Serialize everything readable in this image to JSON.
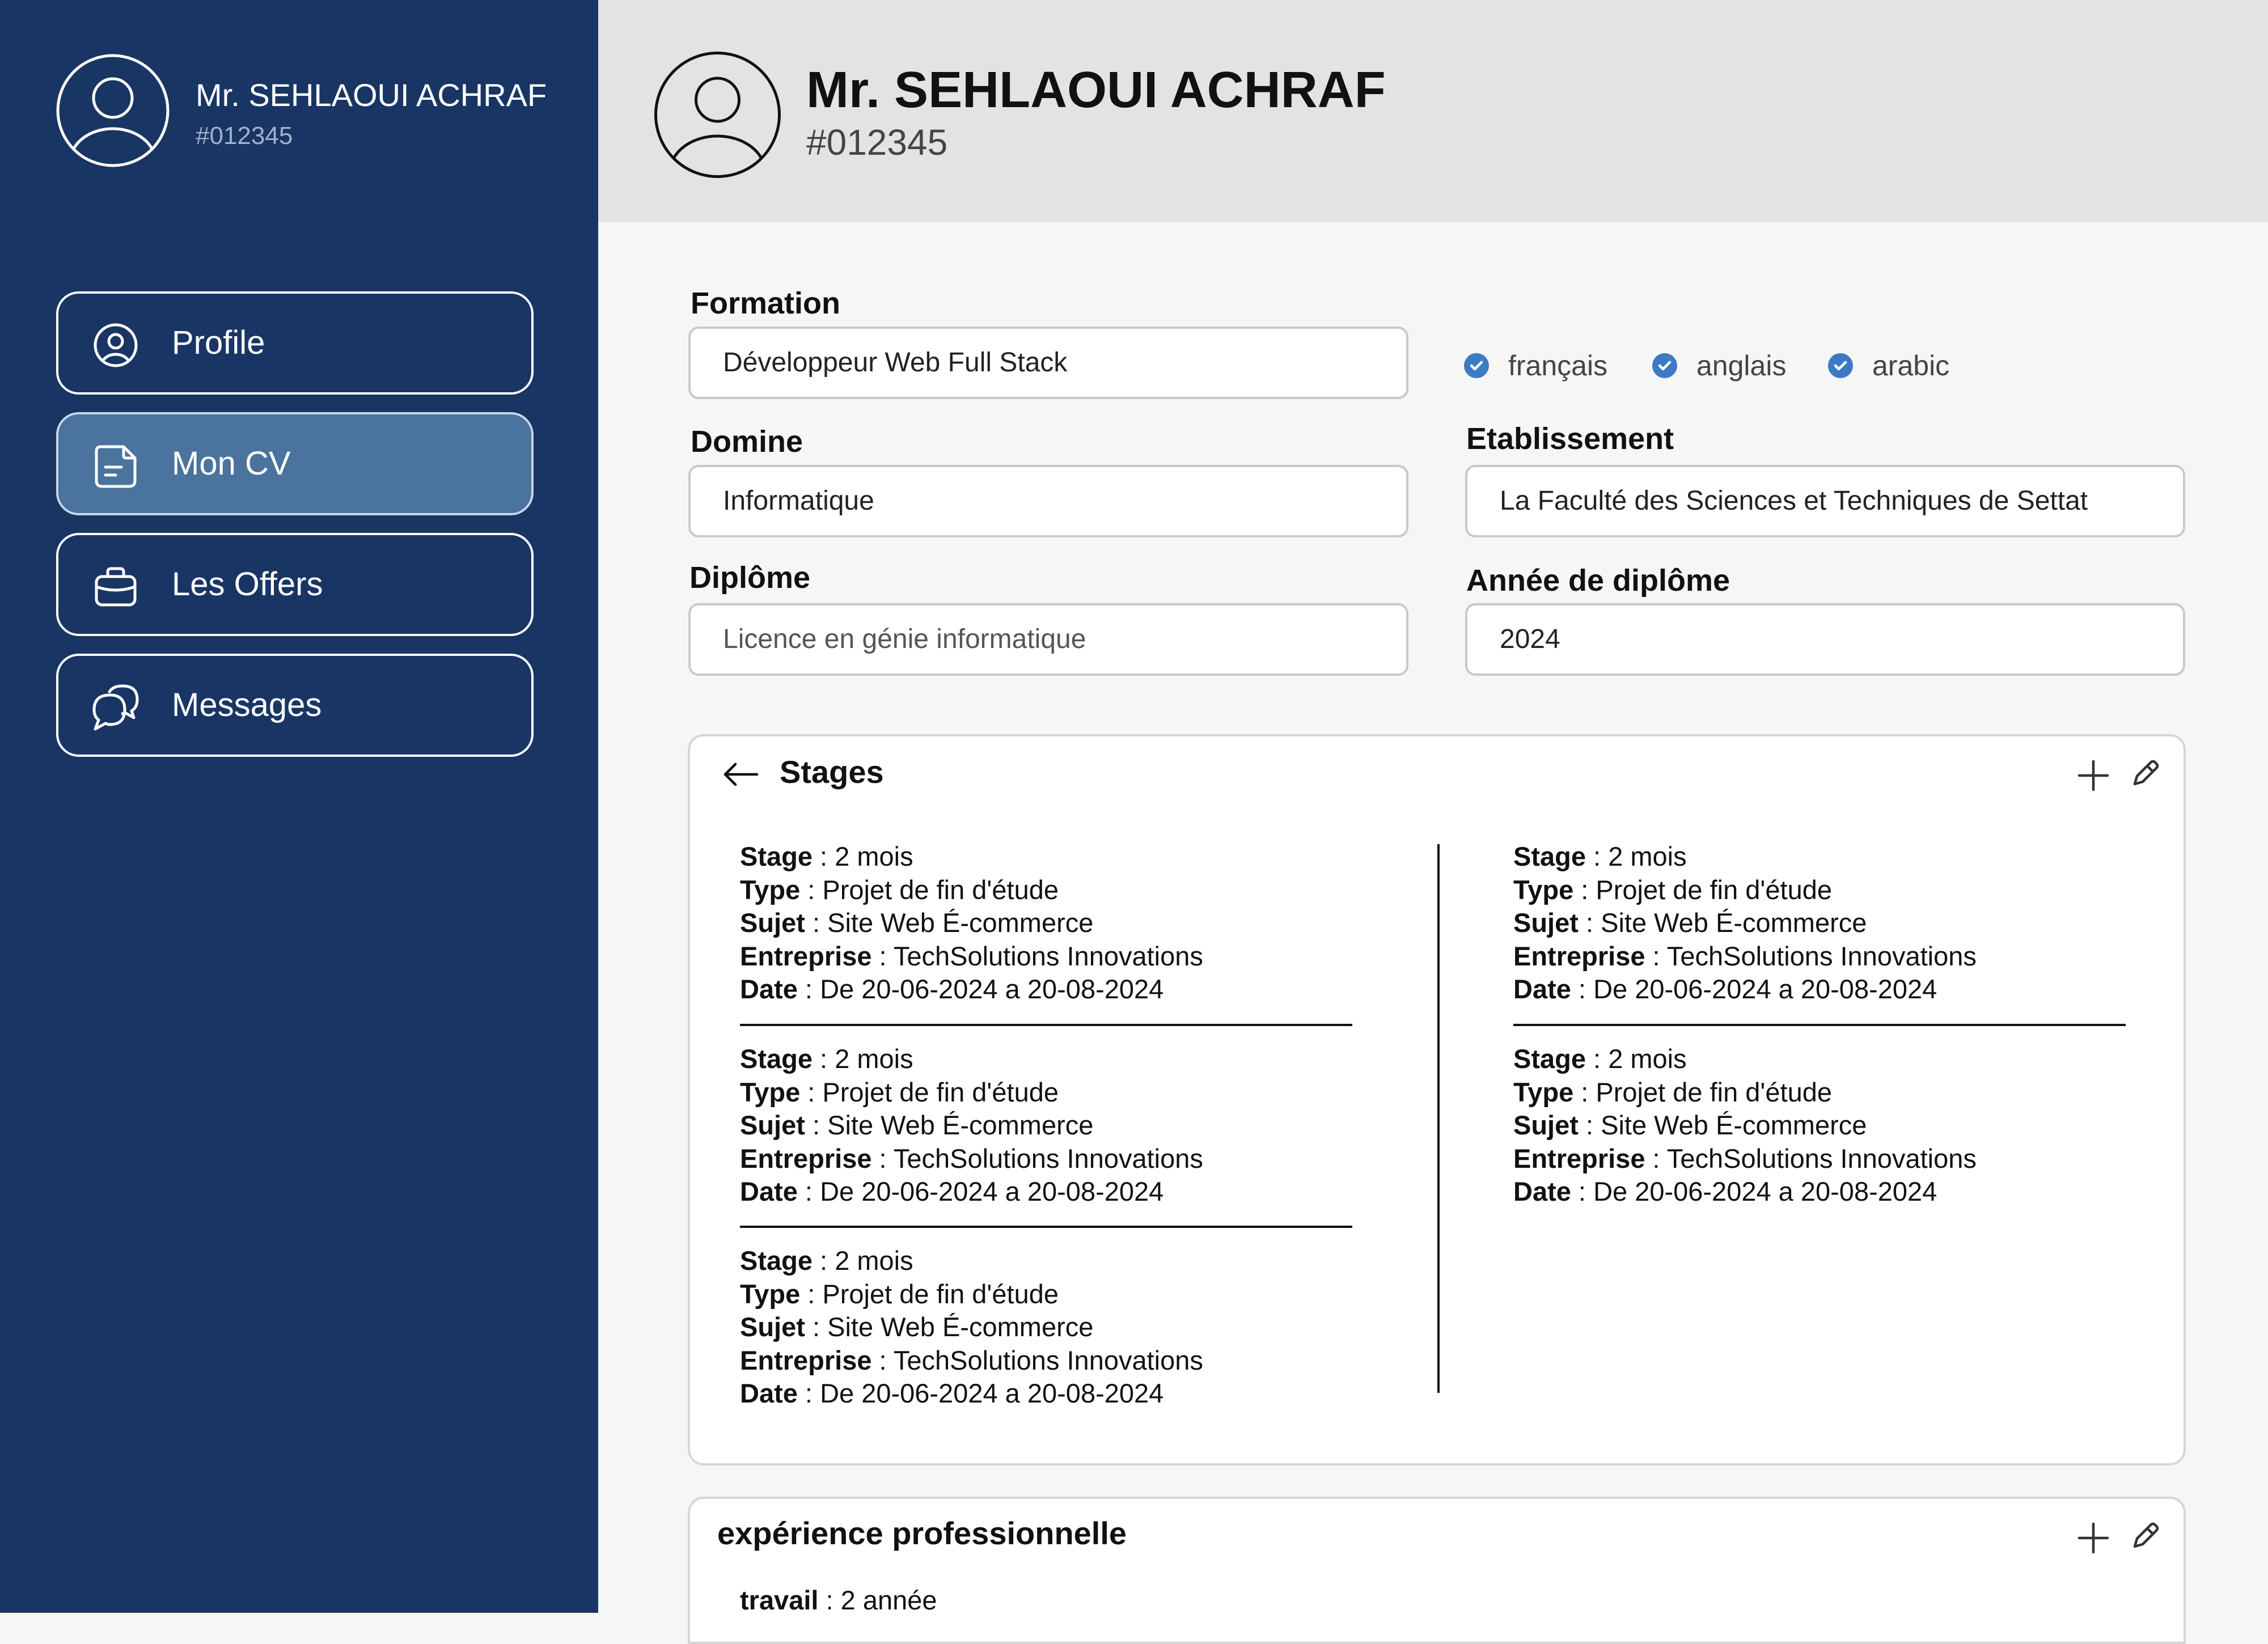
{
  "user": {
    "name": "Mr. SEHLAOUI ACHRAF",
    "id": "#012345"
  },
  "sidebar": {
    "items": [
      {
        "label": "Profile",
        "icon": "user-circle-icon",
        "active": false
      },
      {
        "label": "Mon CV",
        "icon": "document-icon",
        "active": true
      },
      {
        "label": "Les Offers",
        "icon": "briefcase-icon",
        "active": false
      },
      {
        "label": "Messages",
        "icon": "chat-bubbles-icon",
        "active": false
      }
    ]
  },
  "form": {
    "formation": {
      "label": "Formation",
      "value": "Développeur Web Full Stack"
    },
    "languages": [
      "français",
      "anglais",
      "arabic"
    ],
    "domaine": {
      "label": "Domine",
      "value": "Informatique"
    },
    "etablissement": {
      "label": "Etablissement",
      "value": "La Faculté des Sciences et Techniques de Settat"
    },
    "diplome": {
      "label": "Diplôme",
      "value": "Licence en génie informatique"
    },
    "annee": {
      "label": "Année de diplôme",
      "value": "2024"
    }
  },
  "stages": {
    "title": "Stages",
    "keys": {
      "stage": "Stage",
      "type": "Type",
      "sujet": "Sujet",
      "entreprise": "Entreprise",
      "date": "Date"
    },
    "entries": [
      {
        "stage": "2 mois",
        "type": "Projet de fin d'étude",
        "sujet": "Site Web É-commerce",
        "entreprise": "TechSolutions Innovations",
        "date": "De 20-06-2024 a 20-08-2024"
      },
      {
        "stage": "2 mois",
        "type": "Projet de fin d'étude",
        "sujet": "Site Web É-commerce",
        "entreprise": "TechSolutions Innovations",
        "date": "De 20-06-2024 a 20-08-2024"
      },
      {
        "stage": "2 mois",
        "type": "Projet de fin d'étude",
        "sujet": "Site Web É-commerce",
        "entreprise": "TechSolutions Innovations",
        "date": "De 20-06-2024 a 20-08-2024"
      },
      {
        "stage": "2 mois",
        "type": "Projet de fin d'étude",
        "sujet": "Site Web É-commerce",
        "entreprise": "TechSolutions Innovations",
        "date": "De 20-06-2024 a 20-08-2024"
      },
      {
        "stage": "2 mois",
        "type": "Projet de fin d'étude",
        "sujet": "Site Web É-commerce",
        "entreprise": "TechSolutions Innovations",
        "date": "De 20-06-2024 a 20-08-2024"
      }
    ]
  },
  "experience": {
    "title": "expérience professionnelle",
    "first_key": "travail",
    "first_value": "2 année"
  }
}
